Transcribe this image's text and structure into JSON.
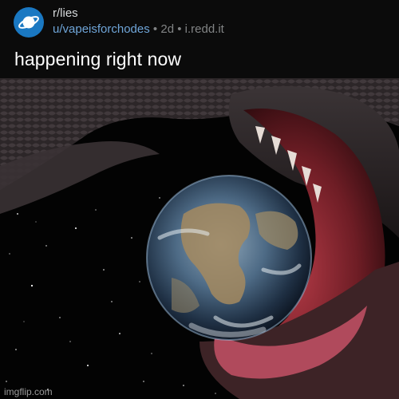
{
  "post": {
    "subreddit": "r/lies",
    "author": "u/vapeisforchodes",
    "separator": "•",
    "age": "2d",
    "domain": "i.redd.it",
    "title": "happening right now"
  },
  "image": {
    "subject": "snake-swallowing-earth"
  },
  "watermark": "imgflip.com",
  "colors": {
    "header_bg": "#0b0b0b",
    "avatar_bg": "#1a78c2",
    "username": "#6fa5d8",
    "meta": "#818384",
    "title": "#ffffff"
  },
  "icons": {
    "subreddit_avatar": "planet-icon"
  }
}
